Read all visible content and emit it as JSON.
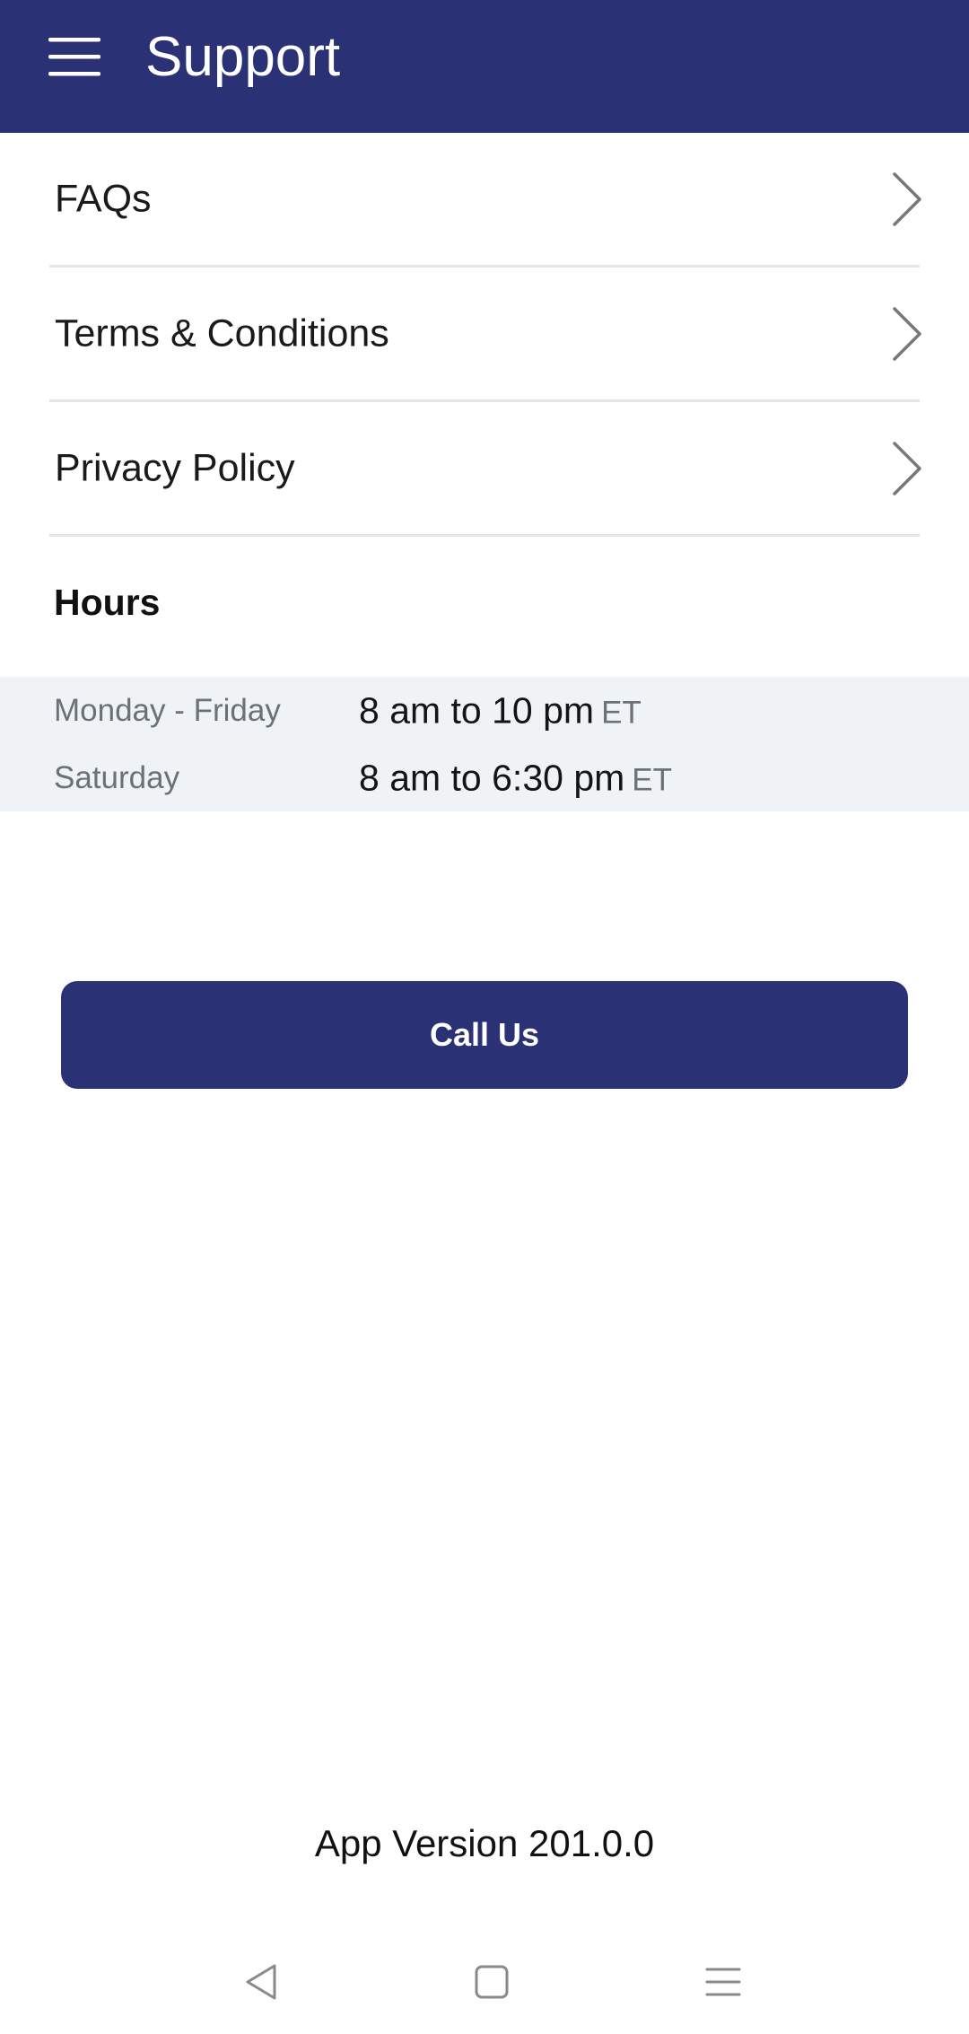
{
  "header": {
    "title": "Support",
    "menu_icon": "hamburger-menu-icon",
    "background_color": "#2a3174"
  },
  "menu": {
    "items": [
      {
        "label": "FAQs",
        "icon": "chevron-right-icon"
      },
      {
        "label": "Terms & Conditions",
        "icon": "chevron-right-icon"
      },
      {
        "label": "Privacy Policy",
        "icon": "chevron-right-icon"
      }
    ]
  },
  "hours": {
    "heading": "Hours",
    "rows": [
      {
        "day": "Monday - Friday",
        "range": "8 am to 10 pm",
        "timezone": "ET"
      },
      {
        "day": "Saturday",
        "range": "8 am to 6:30 pm",
        "timezone": "ET"
      }
    ]
  },
  "actions": {
    "call_label": "Call Us"
  },
  "footer": {
    "version": "App Version 201.0.0"
  },
  "system_nav": {
    "back_icon": "back-triangle-icon",
    "home_icon": "home-square-icon",
    "recents_icon": "recents-menu-icon"
  },
  "colors": {
    "primary": "#2a3174",
    "panel": "#eff3f6",
    "divider": "#e6e6e6",
    "muted_text": "#6b7178"
  }
}
